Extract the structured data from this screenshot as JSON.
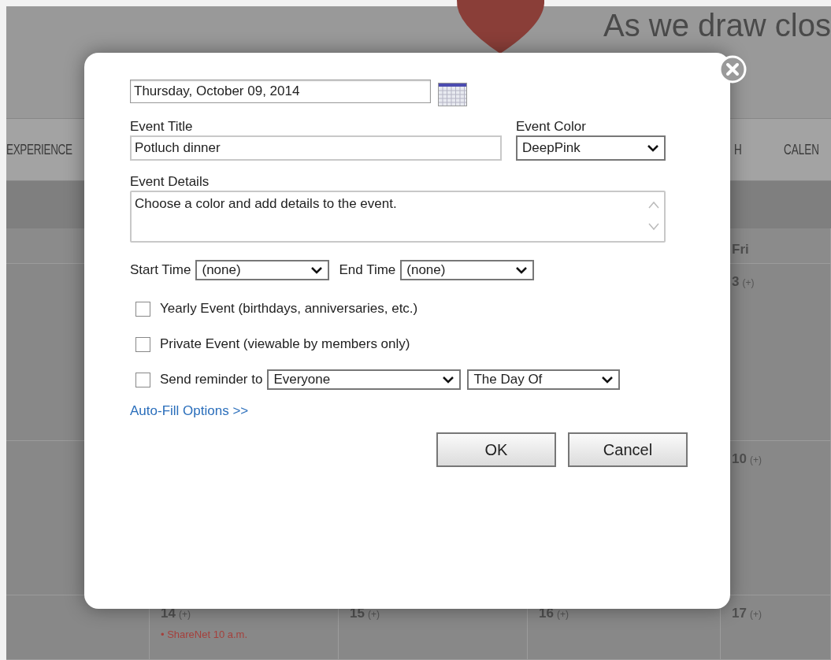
{
  "background": {
    "heading": "As we draw clos",
    "nav": [
      "EXPERIENCE",
      "H",
      "CALEN"
    ],
    "calendar": {
      "header": [
        {
          "kind": "blank"
        },
        {
          "kind": "blank"
        },
        {
          "kind": "blank"
        },
        {
          "kind": "blank"
        },
        {
          "kind": "day",
          "label": "Fri"
        }
      ],
      "rows": [
        {
          "cells": [
            {
              "kind": "blank"
            },
            {
              "kind": "blank"
            },
            {
              "kind": "blank"
            },
            {
              "kind": "blank"
            },
            {
              "kind": "day",
              "day": "3",
              "add": "(+)"
            }
          ]
        },
        {
          "cells": [
            {
              "kind": "blank"
            },
            {
              "kind": "blank"
            },
            {
              "kind": "blank"
            },
            {
              "kind": "blank"
            },
            {
              "kind": "day",
              "day": "10",
              "add": "(+)"
            }
          ]
        },
        {
          "cells": [
            {
              "kind": "blank"
            },
            {
              "kind": "day",
              "day": "14",
              "add": "(+)",
              "events": [
                "• ShareNet 10 a.m."
              ]
            },
            {
              "kind": "day",
              "day": "15",
              "add": "(+)"
            },
            {
              "kind": "day",
              "day": "16",
              "add": "(+)"
            },
            {
              "kind": "day",
              "day": "17",
              "add": "(+)"
            }
          ]
        }
      ]
    }
  },
  "dialog": {
    "date": {
      "value": "Thursday, October 09, 2014"
    },
    "title_label": "Event Title",
    "title": {
      "value": "Potluch dinner"
    },
    "color_label": "Event Color",
    "color": {
      "value": "DeepPink"
    },
    "details_label": "Event Details",
    "details": {
      "value": "Choose a color and add details to the event."
    },
    "start_label": "Start Time",
    "start": {
      "value": "(none)"
    },
    "end_label": "End Time",
    "end": {
      "value": "(none)"
    },
    "options": [
      {
        "label": "Yearly Event (birthdays, anniversaries, etc.)",
        "checked": false
      },
      {
        "label": "Private Event (viewable by members only)",
        "checked": false
      },
      {
        "label": "Send reminder to",
        "checked": false,
        "selects": [
          "Everyone",
          "The Day Of"
        ]
      }
    ],
    "link": "Auto-Fill Options >>",
    "buttons": [
      "OK",
      "Cancel"
    ]
  }
}
